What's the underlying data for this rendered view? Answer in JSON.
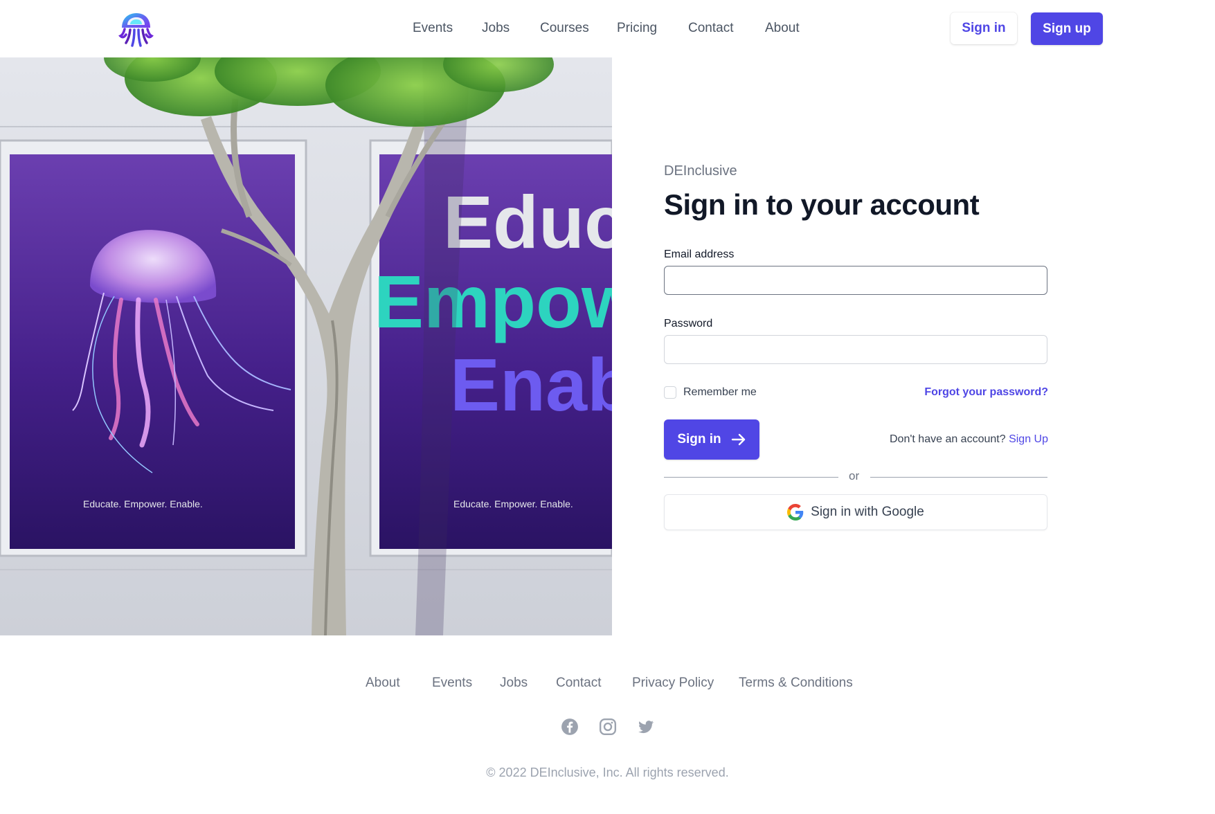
{
  "header": {
    "logo_icon": "jellyfish-logo-icon",
    "nav": [
      {
        "label": "Events"
      },
      {
        "label": "Jobs"
      },
      {
        "label": "Courses"
      },
      {
        "label": "Pricing"
      },
      {
        "label": "Contact"
      },
      {
        "label": "About"
      }
    ],
    "sign_in_label": "Sign in",
    "sign_up_label": "Sign up"
  },
  "hero": {
    "poster_left_caption": "Educate. Empower. Enable.",
    "poster_right_caption": "Educate. Empower. Enable.",
    "poster_right_words": [
      "Educ",
      "Empow",
      "Enab"
    ]
  },
  "form": {
    "brand": "DEInclusive",
    "title": "Sign in to your account",
    "email_label": "Email address",
    "email_value": "",
    "password_label": "Password",
    "password_value": "",
    "remember_label": "Remember me",
    "remember_checked": false,
    "forgot_label": "Forgot your password?",
    "submit_label": "Sign in",
    "no_account_text": "Don't have an account?",
    "signup_link": "Sign Up",
    "divider_text": "or",
    "google_label": "Sign in with Google"
  },
  "footer": {
    "links": [
      {
        "label": "About"
      },
      {
        "label": "Events"
      },
      {
        "label": "Jobs"
      },
      {
        "label": "Contact"
      },
      {
        "label": "Privacy Policy"
      },
      {
        "label": "Terms & Conditions"
      }
    ],
    "social": [
      "facebook-icon",
      "instagram-icon",
      "twitter-icon"
    ],
    "copyright": "© 2022 DEInclusive, Inc. All rights reserved."
  },
  "colors": {
    "primary": "#4f46e5",
    "text": "#111827",
    "muted": "#6b7280"
  }
}
